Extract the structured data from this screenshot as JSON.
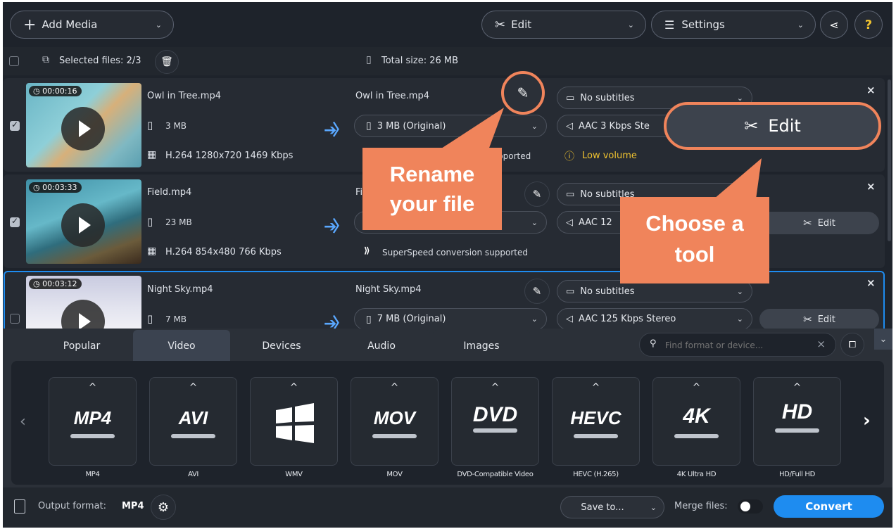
{
  "toolbar": {
    "add_media": "Add Media",
    "edit": "Edit",
    "settings": "Settings"
  },
  "selection_bar": {
    "selected_files": "Selected files: 2/3",
    "total_size": "Total size: 26 MB"
  },
  "files": [
    {
      "duration": "00:00:16",
      "name": "Owl in Tree.mp4",
      "size": "3 MB",
      "codec": "H.264 1280x720 1469 Kbps",
      "output_name": "Owl in Tree.mp4",
      "output_size": "3 MB (Original)",
      "status": "pported",
      "subtitles": "No subtitles",
      "audio": "AAC 3 Kbps Ste",
      "warning": "Low volume",
      "edit": "Edit",
      "checked": true
    },
    {
      "duration": "00:03:33",
      "name": "Field.mp4",
      "size": "23 MB",
      "codec": "H.264 854x480 766 Kbps",
      "output_name": "Fi",
      "status": "SuperSpeed conversion supported",
      "subtitles": "No subtitles",
      "audio": "AAC 12",
      "edit": "Edit",
      "checked": true
    },
    {
      "duration": "00:03:12",
      "name": "Night Sky.mp4",
      "size": "7 MB",
      "output_name": "Night Sky.mp4",
      "output_size": "7 MB (Original)",
      "subtitles": "No subtitles",
      "audio": "AAC 125 Kbps Stereo",
      "edit": "Edit",
      "checked": false
    }
  ],
  "callouts": {
    "rename": "Rename your file",
    "choose": "Choose a tool"
  },
  "tabs": [
    "Popular",
    "Video",
    "Devices",
    "Audio",
    "Images"
  ],
  "active_tab": "Video",
  "search": {
    "placeholder": "Find format or device..."
  },
  "formats": [
    {
      "logo": "MP4",
      "label": "MP4"
    },
    {
      "logo": "AVI",
      "label": "AVI"
    },
    {
      "logo": "",
      "label": "WMV"
    },
    {
      "logo": "MOV",
      "label": "MOV"
    },
    {
      "logo": "DVD",
      "label": "DVD-Compatible Video"
    },
    {
      "logo": "HEVC",
      "label": "HEVC (H.265)"
    },
    {
      "logo": "4K",
      "label": "4K Ultra HD"
    },
    {
      "logo": "HD",
      "label": "HD/Full HD"
    }
  ],
  "footer": {
    "output_format_label": "Output format:",
    "output_format_value": "MP4",
    "save_to": "Save to...",
    "merge_files": "Merge files:",
    "convert": "Convert"
  },
  "colors": {
    "accent": "#1e8cf0",
    "callout": "#f0845b",
    "background": "#1e232b"
  }
}
